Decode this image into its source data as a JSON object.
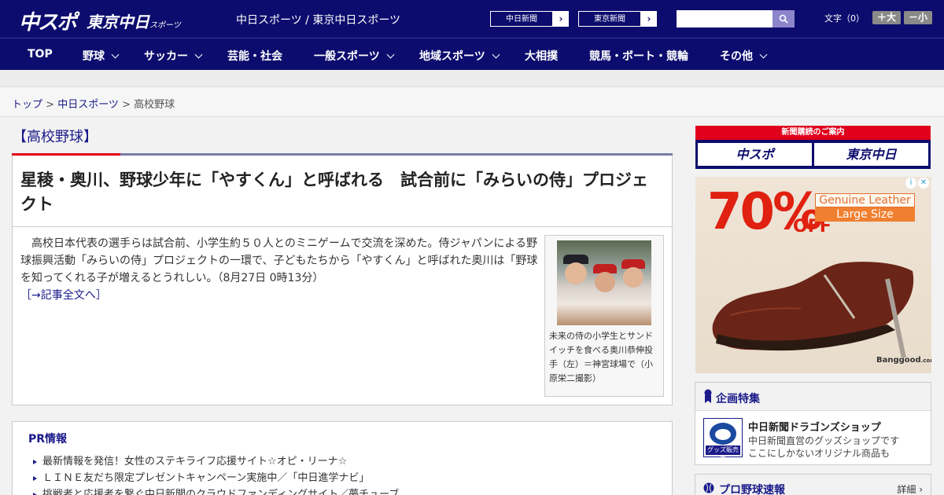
{
  "header": {
    "logo_chuspo": "中スポ",
    "logo_tokyo": "東京中日",
    "logo_tokyo_sub": "スポーツ",
    "site_links": "中日スポーツ / 東京中日スポーツ",
    "ext_chunichi": "中日新聞",
    "ext_tokyo": "東京新聞",
    "ext_arrow": "›",
    "search_placeholder": "",
    "font_label": "文字（0）",
    "font_up": "＋大",
    "font_down": "－小"
  },
  "nav": {
    "items": [
      {
        "label": "TOP"
      },
      {
        "label": "野球"
      },
      {
        "label": "サッカー"
      },
      {
        "label": "芸能・社会"
      },
      {
        "label": "一般スポーツ"
      },
      {
        "label": "地域スポーツ"
      },
      {
        "label": "大相撲"
      },
      {
        "label": "競馬・ボート・競輪"
      },
      {
        "label": "その他"
      }
    ]
  },
  "breadcrumb": {
    "top": "トップ",
    "sep": " > ",
    "chunichi": "中日スポーツ",
    "current": "高校野球"
  },
  "article": {
    "category": "【高校野球】",
    "headline": "星稜・奥川、野球少年に「やすくん」と呼ばれる　試合前に「みらいの侍」プロジェクト",
    "body": "高校日本代表の選手らは試合前、小学生約５０人とのミニゲームで交流を深めた。侍ジャパンによる野球振興活動「みらいの侍」プロジェクトの一環で、子どもたちから「やすくん」と呼ばれた奥川は「野球を知ってくれる子が増えるとうれしい。（8月27日 0時13分）",
    "more": "［→記事全文へ］",
    "photo_caption": "未来の侍の小学生とサンドイッチを食べる奥川恭伸投手（左）＝神宮球場で（小原栄二撮影）"
  },
  "pr": {
    "title": "PR情報",
    "items": [
      "最新情報を発信！女性のステキライフ応援サイト☆オピ・リーナ☆",
      "ＬＩＮＥ友だち限定プレゼントキャンペーン実施中／「中日進学ナビ」",
      "挑戦者と応援者を繋ぐ中日新聞のクラウドファンディングサイト／夢チューブ"
    ]
  },
  "sidebar": {
    "subs_title": "新聞購読のご案内",
    "subs_chuspo": "中スポ",
    "subs_tokyo": "東京中日",
    "ad": {
      "percent": "70%",
      "off": "OFF",
      "genuine": "Genuine Leather",
      "size": "Large Size",
      "brand": "Banggood",
      "brand_sub": ".com"
    },
    "feature_title": "企画特集",
    "shop_logo_label": "グッズ販売中",
    "shop_name": "中日新聞ドラゴンズショップ",
    "shop_desc1": "中日新聞直営のグッズショップです",
    "shop_desc2": "ここにしかないオリジナル商品も",
    "baseball_title": "プロ野球速報",
    "baseball_detail": "詳細 ›"
  },
  "colors": {
    "brand_navy": "#0c0c6e",
    "accent_red": "#e0001b",
    "link_blue": "#1a1a8a"
  }
}
